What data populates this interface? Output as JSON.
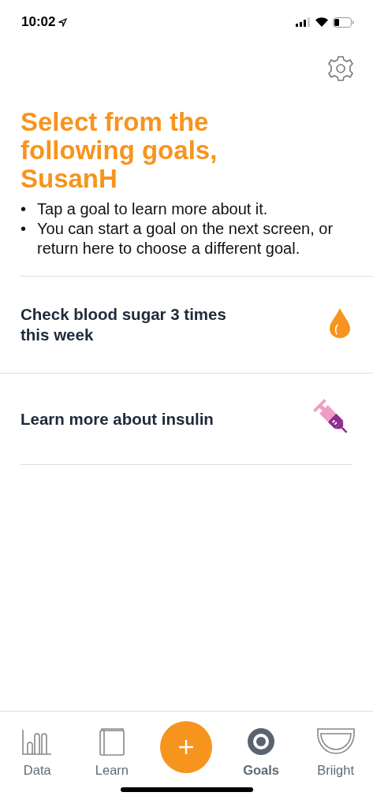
{
  "status_bar": {
    "time": "10:02"
  },
  "heading": "Select from the following goals, SusanH",
  "bullets": [
    {
      "marker": "•",
      "text": "Tap a goal to learn more about it."
    },
    {
      "marker": "•",
      "text": "You can start a goal on the next screen, or return here to choose a different goal."
    }
  ],
  "goals": [
    {
      "label": "Check blood sugar 3 times this week",
      "kind": "drop"
    },
    {
      "label": "Learn more about insulin",
      "kind": "syringe"
    }
  ],
  "tabs": [
    {
      "label": "Data",
      "kind": "chart",
      "selected": false
    },
    {
      "label": "Learn",
      "kind": "book",
      "selected": false
    },
    {
      "kind": "add"
    },
    {
      "label": "Goals",
      "kind": "target",
      "selected": true
    },
    {
      "label": "Briight",
      "kind": "bowl",
      "selected": false
    }
  ]
}
